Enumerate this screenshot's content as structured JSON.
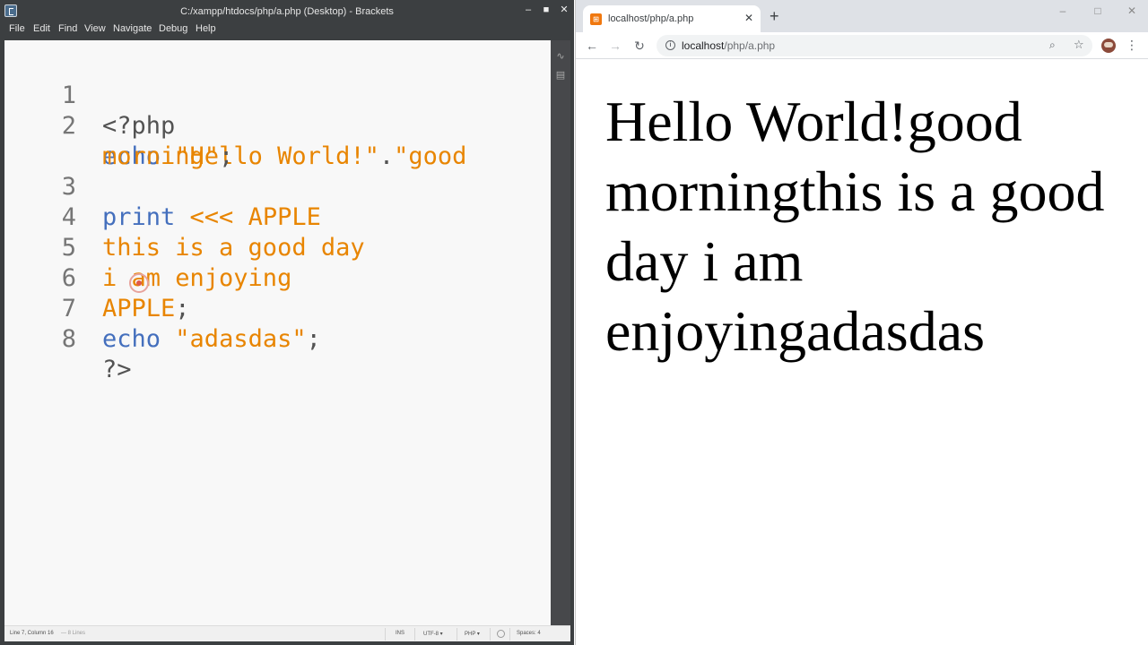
{
  "editor_window": {
    "title": "C:/xampp/htdocs/php/a.php (Desktop) - Brackets",
    "menu": [
      "File",
      "Edit",
      "Find",
      "View",
      "Navigate",
      "Debug",
      "Help"
    ],
    "code": {
      "line_numbers": [
        "1",
        "2",
        "3",
        "4",
        "5",
        "6",
        "7",
        "8"
      ],
      "line1": "<?php",
      "line2_kw": "echo",
      "line2_str1": "\"Hello World!\"",
      "line2_dot": ".",
      "line2_str2": "\"good",
      "line2_wrap": "morning\"",
      "line2_semi": ";",
      "line3_kw": "print",
      "line3_op": "<<<",
      "line3_str": "APPLE",
      "line4": "this is a good day",
      "line5": "i am enjoying",
      "line6_str": "APPLE",
      "line6_semi": ";",
      "line7_kw": "echo",
      "line7_str": "\"adasdas\"",
      "line7_semi": ";",
      "line8": "?>"
    },
    "status": {
      "position": "Line 7, Column 16",
      "lines": "— 8 Lines",
      "mode": "INS",
      "encoding": "UTF-8 ▾",
      "language": "PHP ▾",
      "spaces": "Spaces: 4"
    },
    "icons": [
      "brackets-app-icon",
      "live-preview-icon",
      "extension-manager-icon"
    ]
  },
  "browser_window": {
    "tab_title": "localhost/php/a.php",
    "url_host": "localhost",
    "url_path": "/php/a.php",
    "page_text": "Hello World!good morningthis is a good day i am enjoyingadasdas",
    "icons": [
      "xampp-favicon",
      "back-icon",
      "forward-icon",
      "reload-icon",
      "info-icon",
      "zoom-icon",
      "star-icon",
      "avatar",
      "menu-icon"
    ]
  },
  "colors": {
    "keyword": "#446fbd",
    "string": "#e88501",
    "plain": "#535353",
    "line_number": "#767676",
    "editor_bg": "#f8f8f8",
    "chrome_frame": "#3c3f41"
  }
}
